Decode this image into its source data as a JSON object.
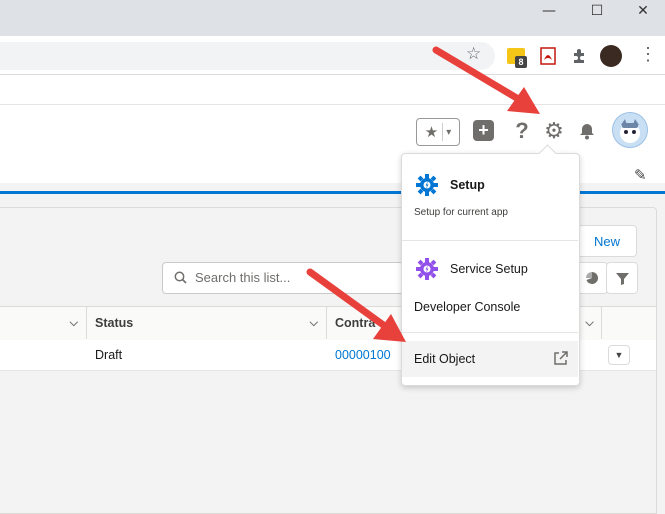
{
  "window": {
    "minimize_glyph": "—",
    "maximize_glyph": "☐",
    "close_glyph": "✕"
  },
  "browser_toolbar": {
    "star_glyph": "☆",
    "extensions": [
      {
        "icon": "meeting-extension-icon",
        "badge": "8",
        "color": "#f5c518"
      },
      {
        "icon": "pdf-extension-icon",
        "color": "#c4170e"
      },
      {
        "icon": "puzzle-extensions-icon"
      },
      {
        "icon": "profile-avatar-icon"
      }
    ],
    "menu_glyph": "⋮"
  },
  "header": {
    "favorites_glyph": "★",
    "favorites_caret": "▾",
    "add_glyph": "+",
    "help_glyph": "?",
    "setup_glyph": "⚙",
    "bell_glyph": "🔔",
    "edit_glyph": "✎"
  },
  "list": {
    "new_button": "New",
    "search_placeholder": "Search this list...",
    "columns": [
      {
        "label": "",
        "name": "first-column"
      },
      {
        "label": "Status",
        "name": "status-column"
      },
      {
        "label": "Contra",
        "name": "contract-column"
      }
    ],
    "rows": [
      {
        "status": "Draft",
        "contract": "00000100"
      }
    ]
  },
  "setup_menu": {
    "items": [
      {
        "label": "Setup",
        "sublabel": "Setup for current app",
        "icon_color": "#0176d3"
      },
      {
        "label": "Service Setup",
        "icon_color": "#9050e9"
      },
      {
        "label": "Developer Console"
      },
      {
        "label": "Edit Object"
      }
    ]
  },
  "colors": {
    "brand_blue": "#0176d3",
    "annotation_red": "#e8413c"
  }
}
